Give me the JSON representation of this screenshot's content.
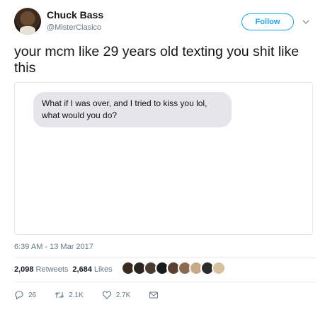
{
  "user": {
    "name": "Chuck Bass",
    "handle": "@MisterClasico"
  },
  "follow_label": "Follow",
  "tweet_text": "your mcm like 29 years old texting you shit like this",
  "message_text": "What if I was over, and I tried to kiss you lol, what would you do?",
  "timestamp": "6:39 AM - 13 Mar 2017",
  "stats": {
    "retweets_count": "2,098",
    "retweets_label": "Retweets",
    "likes_count": "2,684",
    "likes_label": "Likes"
  },
  "liker_avatars": [
    "#3a2a20",
    "#2c2420",
    "#4a3a30",
    "#1a1a1a",
    "#5a4030",
    "#8a6a50",
    "#c8a888",
    "#2a2a2a",
    "#d8c0a0"
  ],
  "actions": {
    "reply_count": "26",
    "retweet_count": "2.1K",
    "like_count": "2.7K"
  },
  "colors": {
    "brand": "#1da1f2",
    "muted": "#657786",
    "bubble": "#e5e5ea"
  },
  "icons": [
    "chevron-down-icon",
    "reply-icon",
    "retweet-icon",
    "heart-icon",
    "envelope-icon"
  ]
}
